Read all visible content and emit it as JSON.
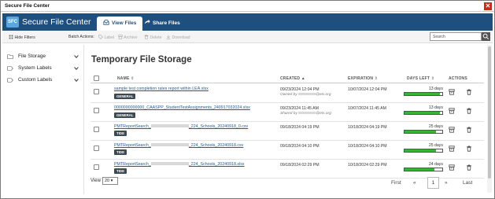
{
  "window": {
    "title": "Secure File Center",
    "close_glyph": "✕"
  },
  "header": {
    "logo_text": "SFC",
    "app_name": "Secure File Center",
    "tabs": [
      {
        "label": "View Files",
        "icon": "tray-icon",
        "active": true
      },
      {
        "label": "Share Files",
        "icon": "share-icon",
        "active": false
      }
    ]
  },
  "toolbar": {
    "hide_filters": "Hide Filters",
    "batch_actions": "Batch Actions:",
    "label": "Label",
    "archive": "Archive",
    "delete": "Delete",
    "download": "Download",
    "search_placeholder": "Search"
  },
  "sidebar": {
    "items": [
      {
        "label": "File Storage",
        "icon": "folder-icon"
      },
      {
        "label": "System Labels",
        "icon": "label-icon"
      },
      {
        "label": "Custom Labels",
        "icon": "label-icon"
      }
    ]
  },
  "main": {
    "title": "Temporary File Storage",
    "columns": {
      "name": "NAME",
      "created": "CREATED",
      "expiration": "EXPIRATION",
      "days_left": "DAYS LEFT",
      "actions": "ACTIONS"
    },
    "rows": [
      {
        "name": "sample test completion rates report within LEA.xlsx",
        "badge": "GENERAL",
        "created": "09/23/2024 12:04 PM",
        "sub_prefix": "Owned by",
        "sub_suffix": "@ets.org",
        "expiration": "10/07/2024 12:04 PM",
        "days_left": "13 days",
        "fraction": 0.93
      },
      {
        "name": "0000000000000_CAASPP_StudentTestAssignments_240917032024.xlsx",
        "badge": "GENERAL",
        "created": "09/23/2024 11:45 AM",
        "sub_prefix": "Shared by",
        "sub_suffix": "@ets.org",
        "expiration": "10/07/2024 11:45 AM",
        "days_left": "13 days",
        "fraction": 0.93
      },
      {
        "name_prefix": "PMTReportSearch_",
        "name_suffix": "_224_Schools_20240918_0.csv",
        "badge": "TIDE",
        "created": "09/18/2024 04:19 PM",
        "expiration": "10/18/2024 04:19 PM",
        "days_left": "25 days",
        "fraction": 0.83
      },
      {
        "name_prefix": "PMTReportSearch_",
        "name_suffix": "_224_Schools_20240918.csv",
        "badge": "TIDE",
        "created": "09/18/2024 04:10 PM",
        "expiration": "10/18/2024 04:10 PM",
        "days_left": "25 days",
        "fraction": 0.83
      },
      {
        "name_prefix": "PMTReportSearch_",
        "name_suffix": "_224_Schools_20240918.xlsx",
        "badge": "TIDE",
        "created": "09/18/2024 02:29 PM",
        "expiration": "10/18/2024 02:29 PM",
        "days_left": "24 days",
        "fraction": 0.8
      }
    ]
  },
  "footer": {
    "view_label": "View",
    "view_value": "20",
    "first": "First",
    "prev": "«",
    "current_page": "1",
    "next": "»",
    "last": "Last"
  },
  "colors": {
    "header": "#1f4f7f",
    "progress": "#38b23a",
    "badge": "#3e4952",
    "close": "#c42b1c"
  }
}
